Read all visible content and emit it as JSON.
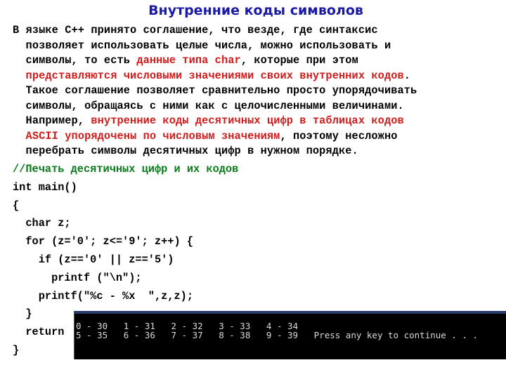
{
  "title": "Внутренние коды символов",
  "paragraph": {
    "lines": [
      [
        {
          "text": "В языке C++ принято соглашение, что везде, где синтаксис",
          "style": "normal"
        }
      ],
      [
        {
          "text": "  позволяет использовать целые числа, можно использовать и",
          "style": "normal"
        }
      ],
      [
        {
          "text": "  символы, то есть ",
          "style": "normal"
        },
        {
          "text": "данные типа char",
          "style": "red"
        },
        {
          "text": ", которые при этом",
          "style": "normal"
        }
      ],
      [
        {
          "text": "  представляются числовыми значениями своих внутренних кодов",
          "style": "red"
        },
        {
          "text": ".",
          "style": "normal"
        }
      ],
      [
        {
          "text": "  Такое соглашение позволяет сравнительно просто упорядочивать",
          "style": "normal"
        }
      ],
      [
        {
          "text": "  символы, обращаясь с ними как с целочисленными величинами.",
          "style": "normal"
        }
      ],
      [
        {
          "text": "  Например, ",
          "style": "normal"
        },
        {
          "text": "внутренние коды десятичных цифр в таблицах кодов",
          "style": "red"
        }
      ],
      [
        {
          "text": "  ASCII упорядочены по числовым значениям",
          "style": "red"
        },
        {
          "text": ", поэтому несложно",
          "style": "normal"
        }
      ],
      [
        {
          "text": "  перебрать символы десятичных цифр в нужном порядке.",
          "style": "normal"
        }
      ]
    ]
  },
  "code": {
    "lines": [
      {
        "text": "//Печать десятичных цифр и их кодов",
        "style": "comment"
      },
      {
        "text": "int main()",
        "style": "normal"
      },
      {
        "text": "{",
        "style": "normal"
      },
      {
        "text": "  char z;",
        "style": "normal"
      },
      {
        "text": "  for (z='0'; z<='9'; z++) {",
        "style": "normal"
      },
      {
        "text": "    if (z=='0' || z=='5')",
        "style": "normal"
      },
      {
        "text": "      printf (\"\\n\");",
        "style": "normal"
      },
      {
        "text": "    printf(\"%c - %x  \",z,z);",
        "style": "normal"
      },
      {
        "text": "  }",
        "style": "normal"
      },
      {
        "text": "  return",
        "style": "normal"
      },
      {
        "text": "}",
        "style": "normal"
      }
    ]
  },
  "console": {
    "lines": [
      "0 - 30   1 - 31   2 - 32   3 - 33   4 - 34",
      "5 - 35   6 - 36   7 - 37   8 - 38   9 - 39   Press any key to continue . . ."
    ]
  },
  "colors": {
    "title": "#1a1aa6",
    "highlight_red": "#d21a1a",
    "comment_green": "#0a7a1a",
    "console_bg": "#000000",
    "console_text": "#d8d8d8"
  }
}
